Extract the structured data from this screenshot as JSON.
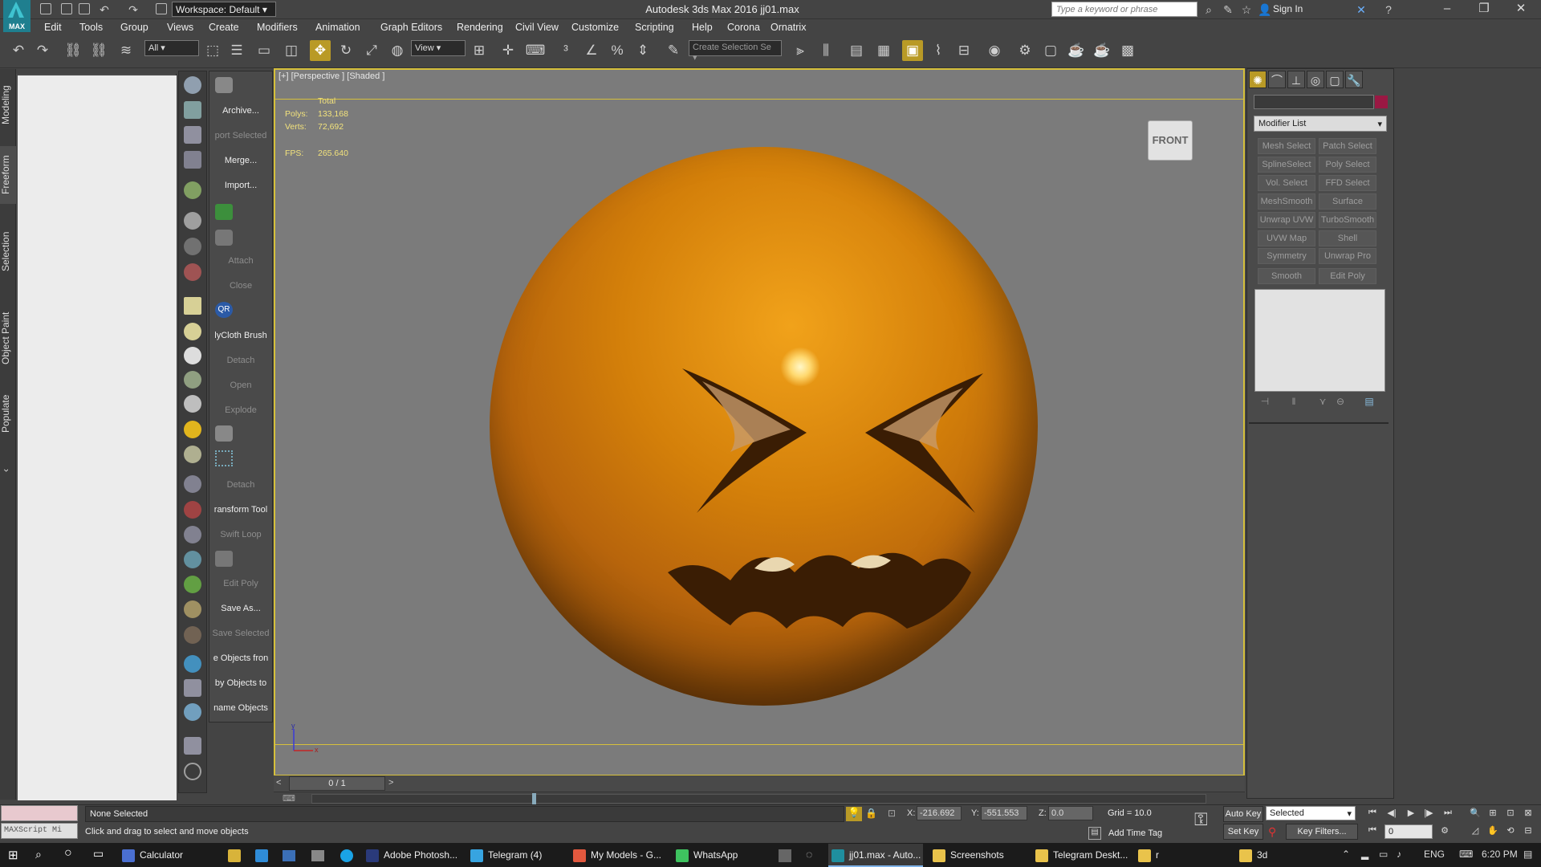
{
  "title_bar": {
    "logo_text": "MAX",
    "workspace": "Workspace: Default",
    "window_title": "Autodesk 3ds Max 2016     jj01.max",
    "search_placeholder": "Type a keyword or phrase",
    "sign_in": "Sign In"
  },
  "menu": [
    "Edit",
    "Tools",
    "Group",
    "Views",
    "Create",
    "Modifiers",
    "Animation",
    "Graph Editors",
    "Rendering",
    "Civil View",
    "Customize",
    "Scripting",
    "Help",
    "Corona",
    "Ornatrix"
  ],
  "toolbar": {
    "selection_filter": "All",
    "ref_coord": "View",
    "selection_set_placeholder": "Create Selection Se"
  },
  "ribbon_tabs": [
    "Modeling",
    "Freeform",
    "Selection",
    "Object Paint",
    "Populate"
  ],
  "command_column": [
    {
      "label": "Archive...",
      "dim": false
    },
    {
      "label": "port Selected",
      "dim": true
    },
    {
      "label": "Merge...",
      "dim": false
    },
    {
      "label": "Import...",
      "dim": false
    },
    {
      "label": "Attach",
      "dim": true
    },
    {
      "label": "Close",
      "dim": true
    },
    {
      "label": "lyCloth Brush",
      "dim": false
    },
    {
      "label": "Detach",
      "dim": true
    },
    {
      "label": "Open",
      "dim": true
    },
    {
      "label": "Explode",
      "dim": true
    },
    {
      "label": "Detach",
      "dim": true
    },
    {
      "label": "ransform Tool",
      "dim": false
    },
    {
      "label": "Swift Loop",
      "dim": true
    },
    {
      "label": "Edit Poly",
      "dim": true
    },
    {
      "label": "Save As...",
      "dim": false
    },
    {
      "label": "Save Selected",
      "dim": true
    },
    {
      "label": "e Objects fron",
      "dim": false
    },
    {
      "label": "by Objects to",
      "dim": false
    },
    {
      "label": "name Objects",
      "dim": false
    }
  ],
  "viewport": {
    "label": "[+] [Perspective ] [Shaded ]",
    "stats_header": "Total",
    "polys_label": "Polys:",
    "polys_value": "133,168",
    "verts_label": "Verts:",
    "verts_value": "72,692",
    "fps_label": "FPS:",
    "fps_value": "265.640",
    "viewcube": "FRONT",
    "axis_y": "y",
    "axis_x": "x"
  },
  "command_panel": {
    "modifier_list": "Modifier List",
    "modifiers": [
      "Mesh Select",
      "Patch Select",
      "SplineSelect",
      "Poly Select",
      "Vol. Select",
      "FFD Select",
      "MeshSmooth",
      "Surface Select",
      "Unwrap UVW",
      "TurboSmooth",
      "UVW Map",
      "Shell",
      "Symmetry",
      "Unwrap Pro",
      "Smooth",
      "Edit Poly"
    ],
    "object_color": "#9a1843"
  },
  "time": {
    "frame": "0 / 1",
    "prev": "<",
    "next": ">"
  },
  "status": {
    "maxscript": "MAXScript Mi",
    "selection": "None Selected",
    "prompt": "Click and drag to select and move objects",
    "x_label": "X:",
    "x_value": "-216.692",
    "y_label": "Y:",
    "y_value": "-551.553",
    "z_label": "Z:",
    "z_value": "0.0",
    "grid": "Grid = 10.0",
    "add_time_tag": "Add Time Tag",
    "auto_key": "Auto Key",
    "set_key": "Set Key",
    "selected": "Selected",
    "key_filters": "Key Filters...",
    "frame_num": "0"
  },
  "taskbar": {
    "apps": [
      {
        "label": "Calculator",
        "color": "#4a6fd1"
      },
      {
        "label": "",
        "color": "#d8b33a"
      },
      {
        "label": "",
        "color": "#2f8cd8"
      },
      {
        "label": "Adobe Photosh...",
        "color": "#2a3a7a"
      },
      {
        "label": "Telegram (4)",
        "color": "#37a4e0"
      },
      {
        "label": "My Models - G...",
        "color": "#e2583e"
      },
      {
        "label": "WhatsApp",
        "color": "#3ec35f"
      },
      {
        "label": "jj01.max - Auto...",
        "color": "#1f8f9f"
      },
      {
        "label": "Screenshots",
        "color": "#e9c34b"
      },
      {
        "label": "Telegram Deskt...",
        "color": "#e9c34b"
      },
      {
        "label": "r",
        "color": "#e9c34b"
      },
      {
        "label": "3d",
        "color": "#e9c34b"
      }
    ],
    "lang": "ENG",
    "time": "6:20 PM"
  }
}
